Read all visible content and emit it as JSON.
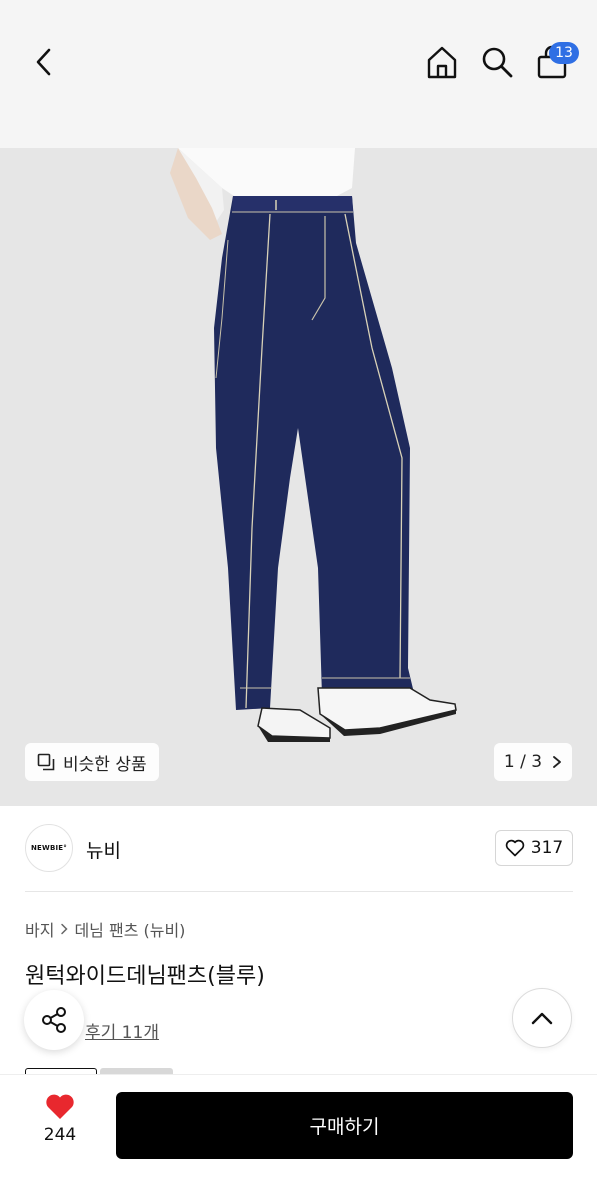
{
  "header": {
    "cart_count": "13"
  },
  "gallery": {
    "similar_label": "비슷한 상품",
    "page_indicator": "1 / 3"
  },
  "brand": {
    "logo_text": "NEWBIE°",
    "name": "뉴비",
    "like_count": "317"
  },
  "product": {
    "breadcrumb": [
      "바지",
      "데님 팬츠 (뉴비)"
    ],
    "title": "원턱와이드데님팬츠(블루)",
    "review_label": "후기 11개"
  },
  "bottom_bar": {
    "heart_count": "244",
    "buy_label": "구매하기"
  },
  "colors": {
    "accent_badge": "#2f6fe4",
    "heart": "#e8282e",
    "buy_button": "#000000",
    "denim": "#1f2a5c"
  },
  "icons": [
    "back-icon",
    "home-icon",
    "search-icon",
    "shopping-bag-icon",
    "similar-items-icon",
    "chevron-right-icon",
    "heart-outline-icon",
    "share-icon",
    "chevron-up-icon",
    "heart-filled-icon"
  ]
}
